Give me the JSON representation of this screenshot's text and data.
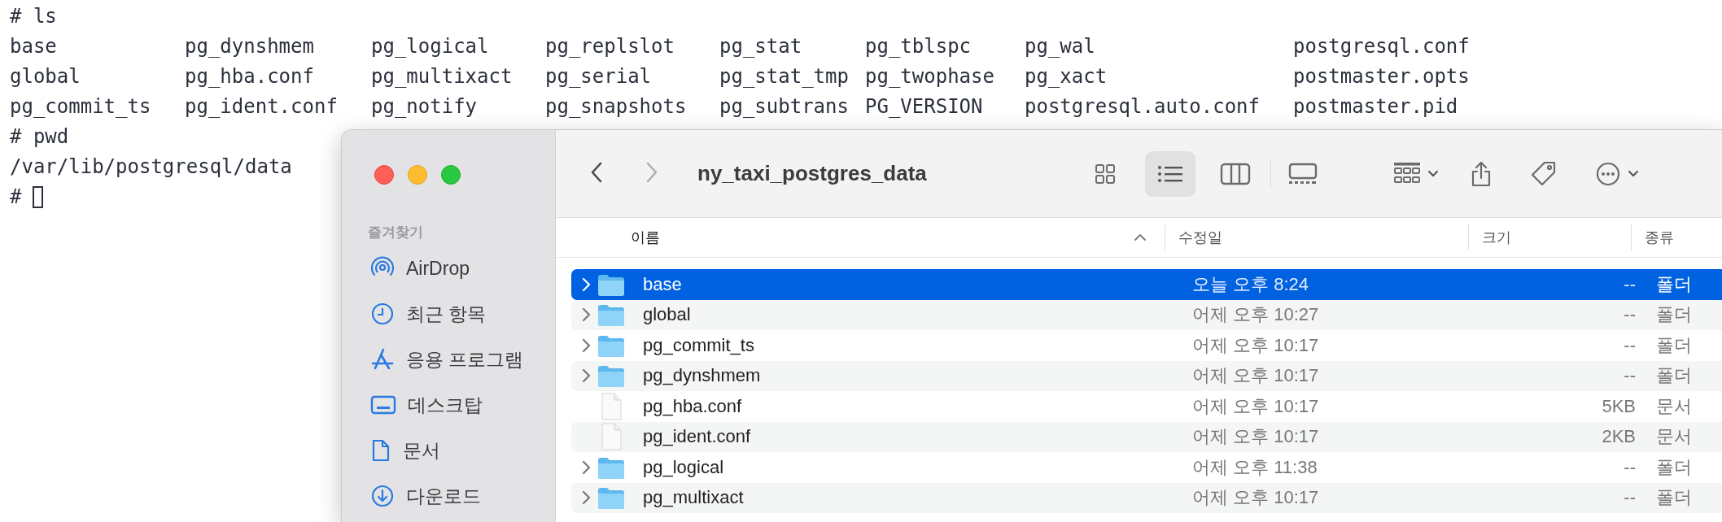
{
  "terminal": {
    "lines": [
      {
        "kind": "command",
        "prompt": "#",
        "text": "ls"
      },
      {
        "kind": "columns",
        "cells": [
          "base",
          "pg_dynshmem",
          "pg_logical",
          "pg_replslot",
          "pg_stat",
          "pg_tblspc",
          "pg_wal",
          "postgresql.conf"
        ]
      },
      {
        "kind": "columns",
        "cells": [
          "global",
          "pg_hba.conf",
          "pg_multixact",
          "pg_serial",
          "pg_stat_tmp",
          "pg_twophase",
          "pg_xact",
          "postmaster.opts"
        ]
      },
      {
        "kind": "columns",
        "cells": [
          "pg_commit_ts",
          "pg_ident.conf",
          "pg_notify",
          "pg_snapshots",
          "pg_subtrans",
          "PG_VERSION",
          "postgresql.auto.conf",
          "postmaster.pid"
        ]
      },
      {
        "kind": "command",
        "prompt": "#",
        "text": "pwd"
      },
      {
        "kind": "output",
        "text": "/var/lib/postgresql/data"
      },
      {
        "kind": "cursor",
        "prompt": "#"
      }
    ]
  },
  "finder": {
    "title": "ny_taxi_postgres_data",
    "view_buttons": [
      {
        "kind": "icons",
        "selected": false
      },
      {
        "kind": "list",
        "selected": true
      },
      {
        "kind": "columns",
        "selected": false
      },
      {
        "kind": "gallery",
        "selected": false
      }
    ],
    "sidebar": {
      "heading": "즐겨찾기",
      "items": [
        {
          "kind": "airdrop",
          "label": "AirDrop"
        },
        {
          "kind": "recent",
          "label": "최근 항목"
        },
        {
          "kind": "apps",
          "label": "응용 프로그램"
        },
        {
          "kind": "desktop",
          "label": "데스크탑"
        },
        {
          "kind": "documents",
          "label": "문서"
        },
        {
          "kind": "downloads",
          "label": "다운로드"
        }
      ]
    },
    "columns": [
      {
        "label": "이름",
        "sorted": true
      },
      {
        "label": "수정일",
        "sorted": false
      },
      {
        "label": "크기",
        "sorted": false
      },
      {
        "label": "종류",
        "sorted": false
      }
    ],
    "rows": [
      {
        "kind": "folder",
        "name": "base",
        "modified": "오늘 오후 8:24",
        "size": "--",
        "type": "폴더",
        "selected": true
      },
      {
        "kind": "folder",
        "name": "global",
        "modified": "어제 오후 10:27",
        "size": "--",
        "type": "폴더",
        "selected": false
      },
      {
        "kind": "folder",
        "name": "pg_commit_ts",
        "modified": "어제 오후 10:17",
        "size": "--",
        "type": "폴더",
        "selected": false
      },
      {
        "kind": "folder",
        "name": "pg_dynshmem",
        "modified": "어제 오후 10:17",
        "size": "--",
        "type": "폴더",
        "selected": false
      },
      {
        "kind": "file",
        "name": "pg_hba.conf",
        "modified": "어제 오후 10:17",
        "size": "5KB",
        "type": "문서",
        "selected": false
      },
      {
        "kind": "file",
        "name": "pg_ident.conf",
        "modified": "어제 오후 10:17",
        "size": "2KB",
        "type": "문서",
        "selected": false
      },
      {
        "kind": "folder",
        "name": "pg_logical",
        "modified": "어제 오후 11:38",
        "size": "--",
        "type": "폴더",
        "selected": false
      },
      {
        "kind": "folder",
        "name": "pg_multixact",
        "modified": "어제 오후 10:17",
        "size": "--",
        "type": "폴더",
        "selected": false
      }
    ]
  }
}
